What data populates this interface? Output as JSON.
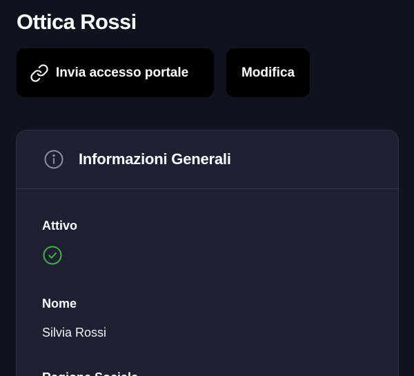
{
  "header": {
    "title": "Ottica Rossi"
  },
  "actions": {
    "portal_label": "Invia accesso portale",
    "portal_icon": "link-icon",
    "edit_label": "Modifica"
  },
  "card": {
    "title": "Informazioni Generali",
    "title_icon": "info-icon",
    "fields": {
      "attivo": {
        "label": "Attivo",
        "value_icon": "check-circle-icon",
        "active": true
      },
      "nome": {
        "label": "Nome",
        "value": "Silvia Rossi"
      },
      "ragione_sociale": {
        "label": "Ragione Sociale"
      }
    }
  },
  "colors": {
    "background": "#10131e",
    "card": "#1d2031",
    "button": "#000000",
    "success": "#4caf50"
  }
}
